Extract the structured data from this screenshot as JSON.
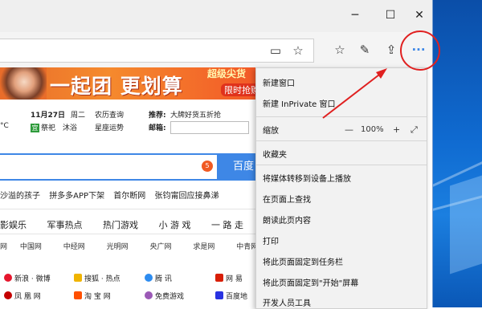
{
  "window": {
    "minimize": "─",
    "maximize": "☐",
    "close": "✕"
  },
  "toolbar": {
    "reading_icon": "reading-view-icon",
    "favorite_icon": "star-icon",
    "hub_icon": "favorites-hub-icon",
    "note_icon": "pen-icon",
    "share_icon": "share-icon",
    "more_label": "···"
  },
  "banner": {
    "main": "一起团 更划算",
    "sub1": "超级尖货",
    "sub2": "限时抢购"
  },
  "info": {
    "date": "11月27日",
    "weekday": "周二",
    "temp": "°C",
    "calendar_label": "祭祀",
    "calendar_item": "沐浴",
    "lookup1": "农历查询",
    "lookup2": "星座运势",
    "recommend_label": "推荐:",
    "recommend_text": "大牌好货五折抢",
    "mail_label": "邮箱:",
    "green_icon": "宜"
  },
  "search": {
    "badge": "5",
    "button": "百度"
  },
  "hot": [
    "沙溢的孩子",
    "拼多多APP下架",
    "首尔断网",
    "张钧甯回应接鼻涕"
  ],
  "categories": [
    "影娱乐",
    "军事热点",
    "热门游戏",
    "小 游 戏",
    "一 路 走"
  ],
  "sites": [
    "网",
    "中国网",
    "中经网",
    "光明网",
    "央广网",
    "求是网",
    "中青网"
  ],
  "links": {
    "weibo": "新浪 · 微博",
    "sohu": "搜狐 · 热点",
    "tencent": "腾  讯",
    "netease": "网  易",
    "ifeng": "凤 凰 网",
    "taobao": "淘 宝 网",
    "games": "免费游戏",
    "baidu": "百度地"
  },
  "menu": {
    "new_window": "新建窗口",
    "new_inprivate": "新建 InPrivate 窗口",
    "zoom": "缩放",
    "zoom_minus": "—",
    "zoom_value": "100%",
    "zoom_plus": "+",
    "fullscreen_icon": "fullscreen-icon",
    "favorites": "收藏夹",
    "cast": "将媒体转移到设备上播放",
    "find": "在页面上查找",
    "read_aloud": "朗读此页内容",
    "print": "打印",
    "pin_taskbar": "将此页面固定到任务栏",
    "pin_start": "将此页面固定到\"开始\"屏幕",
    "dev_tools": "开发人员工具"
  },
  "colors": {
    "annotation_red": "#e02020",
    "search_blue": "#3e87e6",
    "banner_orange": "#f58a2d"
  }
}
